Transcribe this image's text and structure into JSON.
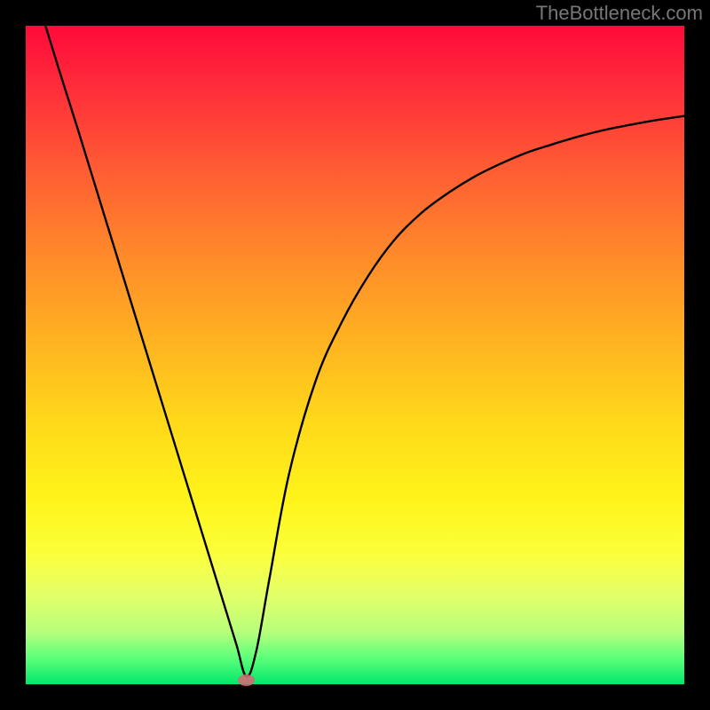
{
  "watermark": {
    "text": "TheBottleneck.com"
  },
  "chart_data": {
    "type": "line",
    "title": "",
    "xlabel": "",
    "ylabel": "",
    "xlim": [
      0,
      100
    ],
    "ylim": [
      0,
      100
    ],
    "series": [
      {
        "name": "bottleneck-curve",
        "x": [
          3,
          5,
          8,
          12,
          16,
          20,
          24,
          28,
          30,
          32,
          33.5,
          35,
          37,
          40,
          44,
          48,
          52,
          56,
          60,
          64,
          68,
          72,
          76,
          80,
          84,
          88,
          92,
          96,
          100
        ],
        "y": [
          100,
          93.5,
          84,
          71,
          58,
          45,
          32,
          19,
          12.5,
          6,
          1.2,
          5,
          16,
          32,
          46,
          55,
          62,
          67.5,
          71.5,
          74.5,
          77,
          79,
          80.7,
          82,
          83.2,
          84.2,
          85,
          85.7,
          86.3
        ]
      }
    ],
    "minimum_point": {
      "x": 33.5,
      "y": 0.6
    },
    "background_gradient": [
      "#ff0a3a",
      "#ffd81a",
      "#00e86a"
    ],
    "colors": {
      "curve": "#000000",
      "marker": "#d46a74"
    }
  }
}
